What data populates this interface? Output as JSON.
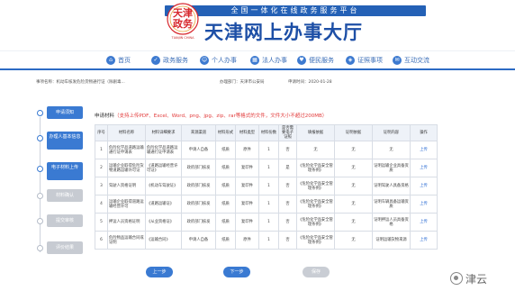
{
  "header": {
    "slogan": "全国一体化在线政务服务平台",
    "logo_text": "天津政务",
    "logo_en": "TIANJIN CHINA",
    "site_title": "天津网上办事大厅",
    "accent": "#2461b6"
  },
  "nav": [
    {
      "label": "首页",
      "icon": "home-icon"
    },
    {
      "label": "政务服务",
      "icon": "service-icon"
    },
    {
      "label": "个人办事",
      "icon": "person-icon"
    },
    {
      "label": "法人办事",
      "icon": "building-icon"
    },
    {
      "label": "便民服务",
      "icon": "convenience-icon"
    },
    {
      "label": "证照事项",
      "icon": "license-icon"
    },
    {
      "label": "互动交流",
      "icon": "chat-icon"
    }
  ],
  "info": {
    "item_name": "事项名称：机动车核发危险货物通行证（除剧毒...",
    "department": "办理部门：天津市公安局",
    "time": "申请时间：2020-01-28"
  },
  "steps": [
    {
      "label": "申请须知",
      "active": true
    },
    {
      "label": "办理人基本信息",
      "active": true
    },
    {
      "label": "电子材料上传",
      "active": true
    },
    {
      "label": "材料确认",
      "active": false
    },
    {
      "label": "提交审核",
      "active": false
    },
    {
      "label": "评价结果",
      "active": false
    }
  ],
  "main": {
    "title": "申请材料",
    "hint": "（支持上传PDF、Excel、Word、png、jpg、zip、rar等格式的文件，文件大小不超过200MB）",
    "columns": [
      "序号",
      "材料名称",
      "材料详细要求",
      "来源渠道",
      "材料形式",
      "材料类型",
      "材料份数",
      "是否需要电子证照",
      "填报依据",
      "证明依据",
      "证明内容",
      "操作"
    ],
    "rows": [
      [
        "1",
        "危险化学品道路运输通行证申请表",
        "危险化学品道路运输通行证申请表",
        "申请人自备",
        "纸质",
        "原件",
        "1",
        "否",
        "无",
        "无",
        "无",
        "上传"
      ],
      [
        "2",
        "运输企业取得危险货物道路运输许可证",
        "《道路运输经营许可证》",
        "政府部门核发",
        "纸质",
        "复印件",
        "1",
        "是",
        "《危险化学品安全管理条例》",
        "无",
        "证明运输企业具备资质",
        "上传"
      ],
      [
        "3",
        "驾驶人资格证明",
        "《机动车驾驶证》",
        "政府部门核发",
        "纸质",
        "复印件",
        "1",
        "否",
        "《危险化学品安全管理条例》",
        "无",
        "证明驾驶人具备资格",
        "上传"
      ],
      [
        "4",
        "运输企业取得道路运输经营许可",
        "《道路运输证》",
        "政府部门核发",
        "纸质",
        "复印件",
        "1",
        "否",
        "《危险化学品安全管理条例》",
        "无",
        "证明车辆具备运输资质",
        "上传"
      ],
      [
        "5",
        "押运人员资格证明",
        "《从业资格证》",
        "政府部门核发",
        "纸质",
        "复印件",
        "1",
        "否",
        "《危险化学品安全管理条例》",
        "无",
        "证明押运人员具备资格",
        "上传"
      ],
      [
        "6",
        "危险物品运输合同或证明",
        "《运输合同》",
        "申请人自备",
        "纸质",
        "原件",
        "1",
        "否",
        "《危险化学品安全管理条例》",
        "无",
        "证明运输货物来源",
        "上传"
      ]
    ]
  },
  "buttons": {
    "prev": "上一步",
    "next": "下一步",
    "save": "保存"
  },
  "watermark": "津云"
}
